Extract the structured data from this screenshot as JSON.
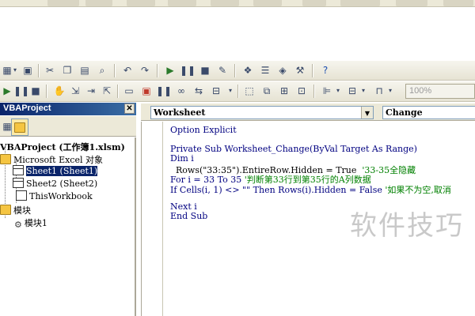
{
  "toolbar": {
    "zoom_value": "100%"
  },
  "project": {
    "title": "VBAProject",
    "close_glyph": "✕",
    "tree": [
      {
        "label": "VBAProject (工作簿1.xlsm)",
        "icon": "project-icon"
      },
      {
        "label": "Microsoft Excel 对象",
        "icon": "folder-icon"
      },
      {
        "label": "Sheet1 (Sheet1)",
        "icon": "sheet-icon",
        "selected": true
      },
      {
        "label": "Sheet2 (Sheet2)",
        "icon": "sheet-icon"
      },
      {
        "label": "ThisWorkbook",
        "icon": "workbook-icon"
      },
      {
        "label": "模块",
        "icon": "folder-icon"
      },
      {
        "label": "模块1",
        "icon": "module-icon"
      }
    ]
  },
  "code": {
    "object_combo": "Worksheet",
    "proc_combo": "Change",
    "lines": {
      "l1": "Option Explicit",
      "l2": "Private Sub Worksheet_Change(ByVal Target As Range)",
      "l3": "Dim i",
      "l4a": "  Rows(\"33:35\").EntireRow.Hidden = True  ",
      "l4b": "'33-35全隐藏",
      "l5a": "For i = 33 To 35 ",
      "l5b": "'判断第33行到第35行的A列数据",
      "l6a": "If Cells(i, 1) <> \"\" Then Rows(i).Hidden = False ",
      "l6b": "'如果不为空,取消",
      "l7": "Next i",
      "l8": "End Sub"
    }
  },
  "watermark": "软件技巧"
}
